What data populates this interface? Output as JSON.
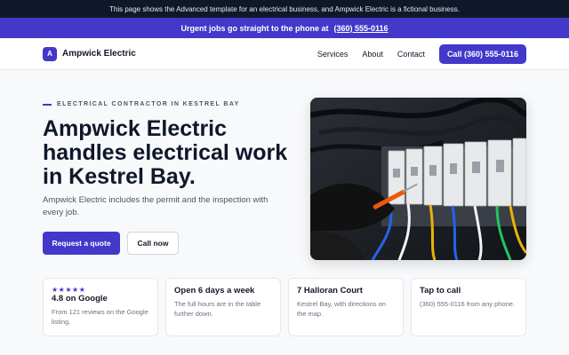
{
  "disclaimer": "This page shows the Advanced template for an electrical business, and Ampwick Electric is a fictional business.",
  "urgent": {
    "text": "Urgent jobs go straight to the phone at",
    "phone": "(360) 555-0116"
  },
  "nav": {
    "badge": "A",
    "brand": "Ampwick Electric",
    "links": [
      "Services",
      "About",
      "Contact"
    ],
    "call": "Call (360) 555-0116"
  },
  "hero": {
    "eyebrow": "ELECTRICAL CONTRACTOR IN KESTREL BAY",
    "headline": "Ampwick Electric handles electrical work in Kestrel Bay.",
    "sub": "Ampwick Electric includes the permit and the inspection with every job.",
    "primary": "Request a quote",
    "secondary": "Call now"
  },
  "cards": [
    {
      "stars": "★★★★★",
      "title": "4.8 on Google",
      "text": "From 121 reviews on the Google listing."
    },
    {
      "title": "Open 6 days a week",
      "text": "The full hours are in the table further down."
    },
    {
      "title": "7 Halloran Court",
      "text": "Kestrel Bay, with directions on the map."
    },
    {
      "title": "Tap to call",
      "text": "(360) 555-0116 from any phone."
    }
  ],
  "colors": {
    "accent": "#4338ca",
    "dark": "#0f172a"
  }
}
